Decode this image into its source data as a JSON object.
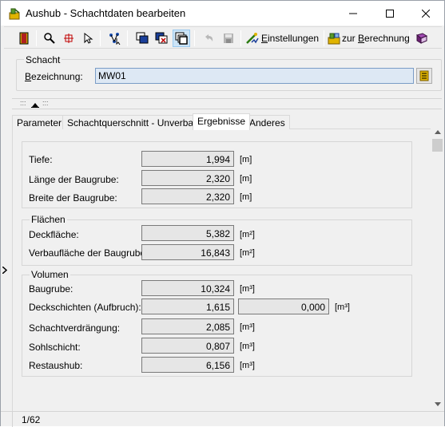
{
  "window": {
    "title": "Aushub - Schachtdaten bearbeiten",
    "minimize_glyph": "—",
    "maximize_glyph": "☐",
    "close_glyph": "✕"
  },
  "toolbar": {
    "einstellungen_label": "Einstellungen",
    "einstellungen_underline": "E",
    "einstellungen_rest": "instellungen",
    "berechnung_prefix": "zur ",
    "berechnung_underline": "B",
    "berechnung_rest": "erechnung"
  },
  "schacht": {
    "group_label": "Schacht",
    "bezeichnung_label_underline": "B",
    "bezeichnung_label_rest": "ezeichnung:",
    "bezeichnung_value": "MW01"
  },
  "tabs": [
    {
      "label": "Parameter"
    },
    {
      "label": "Schachtquerschnitt - Unverbaut"
    },
    {
      "label": "Ergebnisse"
    },
    {
      "label": "Anderes"
    }
  ],
  "results": {
    "rows1": [
      {
        "label": "Tiefe:",
        "value": "1,994",
        "unit": "[m]"
      },
      {
        "label": "Länge der Baugrube:",
        "value": "2,320",
        "unit": "[m]"
      },
      {
        "label": "Breite der Baugrube:",
        "value": "2,320",
        "unit": "[m]"
      }
    ],
    "flaechen_label": "Flächen",
    "flaechen": [
      {
        "label": "Deckfläche:",
        "value": "5,382",
        "unit": "[m²]"
      },
      {
        "label": "Verbaufläche der Baugrube",
        "value": "16,843",
        "unit": "[m²]"
      }
    ],
    "volumen_label": "Volumen",
    "volumen": [
      {
        "label": "Baugrube:",
        "value": "10,324",
        "unit": "[m³]"
      },
      {
        "label": "Deckschichten (Aufbruch):",
        "value": "1,615",
        "extra_value": "0,000",
        "unit": "[m³]"
      },
      {
        "label": "Schachtverdrängung:",
        "value": "2,085",
        "unit": "[m³]"
      },
      {
        "label": "Sohlschicht:",
        "value": "0,807",
        "unit": "[m³]"
      },
      {
        "label": "Restaushub:",
        "value": "6,156",
        "unit": "[m³]"
      }
    ]
  },
  "status": {
    "record": "1/62"
  },
  "colors": {
    "input_bg": "#dde8f4",
    "pressed_bg": "#cce4f7",
    "value_bg": "#e6e6e6"
  }
}
